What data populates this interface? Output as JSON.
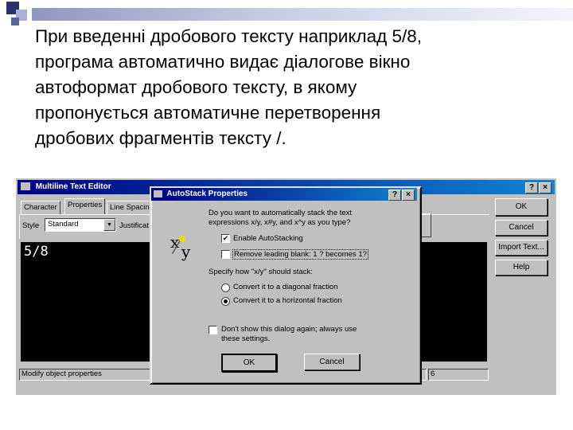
{
  "slide": {
    "lines": [
      "При введенні дробового тексту наприклад 5/8,",
      "програма автоматично видає діалогове вікно",
      "автоформат дробового тексту, в якому",
      "пропонується автоматичне перетворення",
      "дробових фрагментів тексту /."
    ]
  },
  "mtext": {
    "title": "Multiline Text Editor",
    "tabs": [
      "Character",
      "Properties",
      "Line Spacin"
    ],
    "style_label": "Style",
    "style_value": "Standard",
    "justify_label": "Justificat",
    "editor_text": "5/8",
    "status": "Modify object properties",
    "status_right": "6",
    "buttons": {
      "ok": "OK",
      "cancel": "Cancel",
      "import": "Import Text...",
      "help": "Help"
    },
    "help_glyph": "?",
    "close_glyph": "×"
  },
  "dialog": {
    "title": "AutoStack Properties",
    "question_line1": "Do you want to automatically stack the text",
    "question_line2": "expressions x/y, x#y, and x^y as you type?",
    "icon_x": "x",
    "icon_slash": "⁄",
    "icon_y": "y",
    "enable_label": "Enable AutoStacking",
    "enable_checked": true,
    "remove_label": "Remove leading blank:  1 ?  becomes 1?",
    "remove_checked": false,
    "specify_label": "Specify how \"x/y\" should stack:",
    "diag_label": "Convert it to a diagonal fraction",
    "horiz_label": "Convert it to a horizontal fraction",
    "selected_option": "horizontal",
    "dontshow_line1": "Don't show this dialog again; always use",
    "dontshow_line2": "these settings.",
    "dontshow_checked": false,
    "ok_label": "OK",
    "cancel_label": "Cancel",
    "check_glyph": "✔",
    "help_glyph": "?",
    "close_glyph": "×"
  },
  "colors": {
    "titlebar": "#000080",
    "dialog_bg": "#c0c0c0",
    "editor_bg": "#000000",
    "slide_bar": "#8f97c2"
  }
}
